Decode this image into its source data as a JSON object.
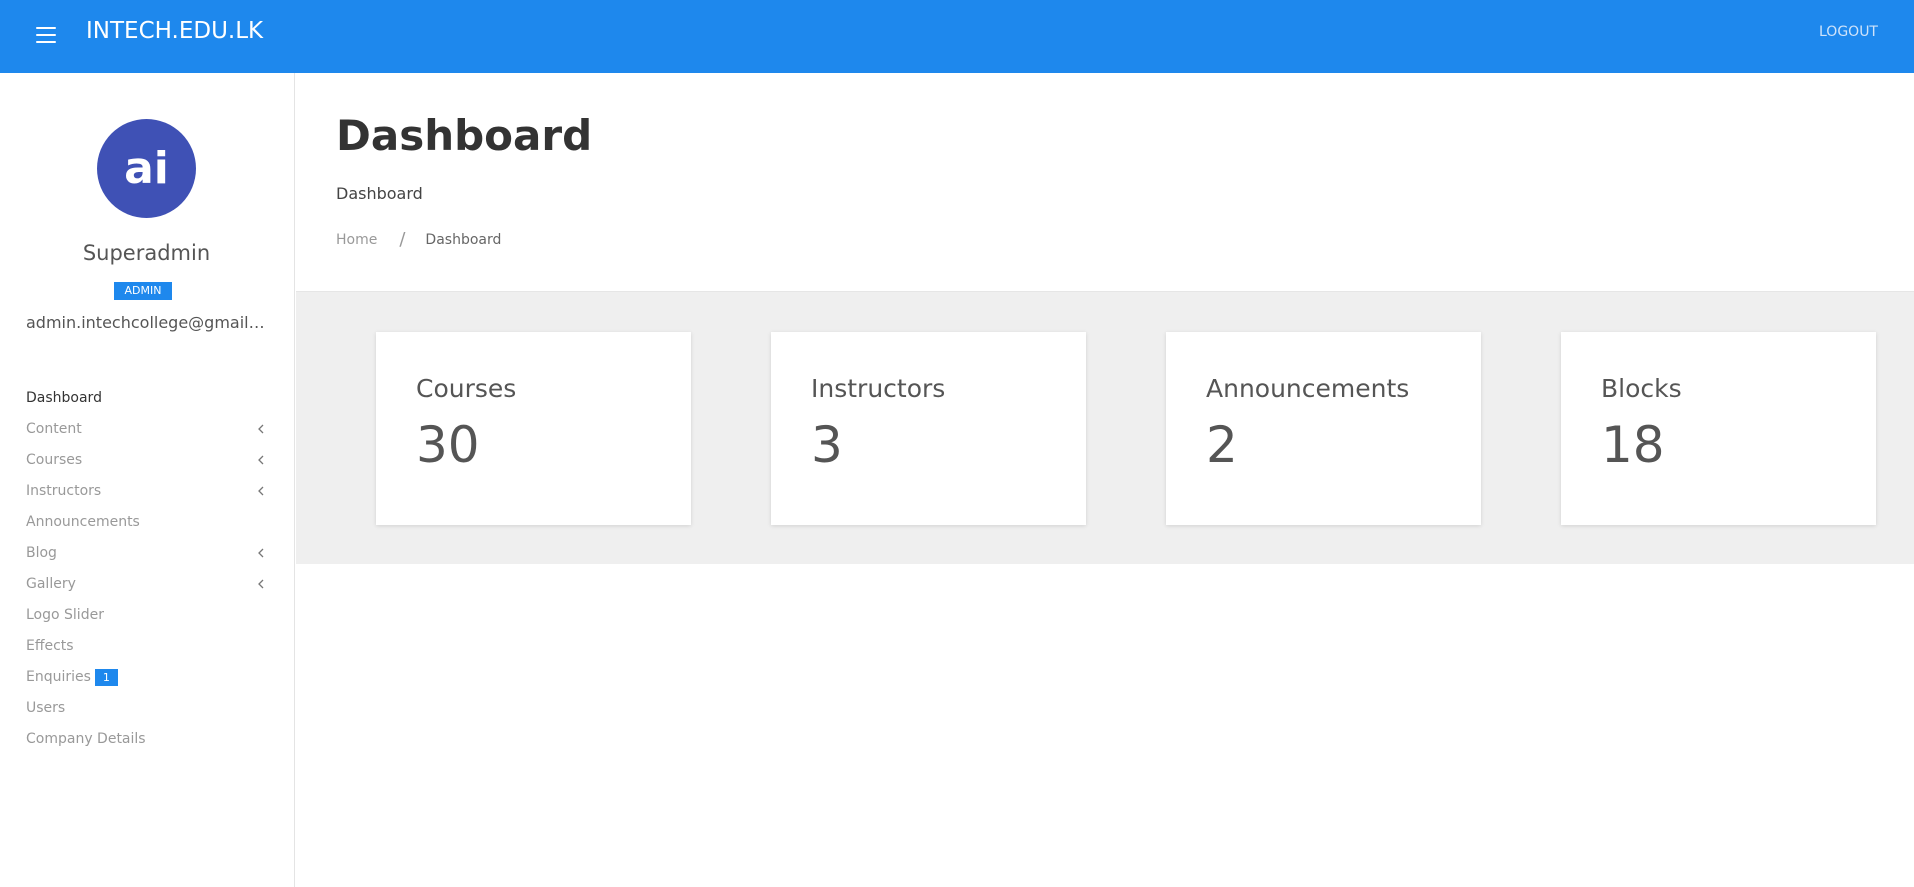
{
  "header": {
    "brand": "INTECH.EDU.LK",
    "logout_label": "LOGOUT",
    "menu_icon": "hamburger-menu-icon",
    "background_color": "#1e88ed"
  },
  "profile": {
    "avatar_text": "ai",
    "avatar_color": "#3f51b5",
    "name": "Superadmin",
    "role": "ADMIN",
    "email": "admin.intechcollege@gmail.com"
  },
  "sidebar": {
    "items": [
      {
        "label": "Dashboard",
        "active": true
      },
      {
        "label": "Content",
        "expandable": true
      },
      {
        "label": "Courses",
        "expandable": true
      },
      {
        "label": "Instructors",
        "expandable": true
      },
      {
        "label": "Announcements"
      },
      {
        "label": "Blog",
        "expandable": true
      },
      {
        "label": "Gallery",
        "expandable": true
      },
      {
        "label": "Logo Slider"
      },
      {
        "label": "Effects"
      },
      {
        "label": "Enquiries",
        "badge": "1"
      },
      {
        "label": "Users"
      },
      {
        "label": "Company Details"
      }
    ]
  },
  "page": {
    "title": "Dashboard",
    "subtitle": "Dashboard",
    "breadcrumb": {
      "home": "Home",
      "separator": "/",
      "current": "Dashboard"
    }
  },
  "stats": [
    {
      "label": "Courses",
      "value": "30"
    },
    {
      "label": "Instructors",
      "value": "3"
    },
    {
      "label": "Announcements",
      "value": "2"
    },
    {
      "label": "Blocks",
      "value": "18"
    }
  ]
}
